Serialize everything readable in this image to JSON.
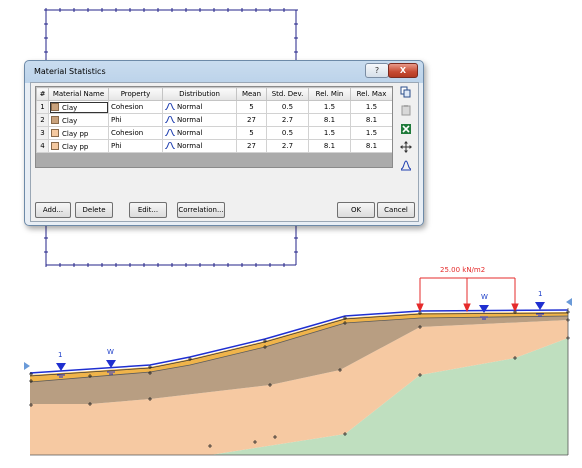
{
  "dialog": {
    "title": "Material Statistics",
    "help_label": "?",
    "close_label": "X"
  },
  "table": {
    "headers": [
      "#",
      "Material Name",
      "Property",
      "Distribution",
      "Mean",
      "Std. Dev.",
      "Rel. Min",
      "Rel. Max"
    ],
    "rows": [
      {
        "num": "1",
        "name": "Clay",
        "property": "Cohesion",
        "distribution": "Normal",
        "mean": "5",
        "std": "0.5",
        "min": "1.5",
        "max": "1.5",
        "color": "#c9a27c"
      },
      {
        "num": "2",
        "name": "Clay",
        "property": "Phi",
        "distribution": "Normal",
        "mean": "27",
        "std": "2.7",
        "min": "8.1",
        "max": "8.1",
        "color": "#c9a27c"
      },
      {
        "num": "3",
        "name": "Clay pp",
        "property": "Cohesion",
        "distribution": "Normal",
        "mean": "5",
        "std": "0.5",
        "min": "1.5",
        "max": "1.5",
        "color": "#f5c9a0"
      },
      {
        "num": "4",
        "name": "Clay pp",
        "property": "Phi",
        "distribution": "Normal",
        "mean": "27",
        "std": "2.7",
        "min": "8.1",
        "max": "8.1",
        "color": "#f5c9a0"
      }
    ]
  },
  "buttons": {
    "add": "Add...",
    "delete": "Delete",
    "edit": "Edit...",
    "correlation": "Correlation...",
    "ok": "OK",
    "cancel": "Cancel"
  },
  "tools": {
    "copy_icon": "copy-icon",
    "paste_icon": "paste-icon",
    "excel_icon": "excel-icon",
    "move_icon": "move-icon",
    "distribution_icon": "distribution-icon"
  },
  "model": {
    "load_label": "25.00 kN/m2",
    "water_label_left_number": "1",
    "water_label_left_w": "W",
    "water_label_right_w": "W",
    "water_label_right_number": "1",
    "colors": {
      "lower_layer": "#bfdfbf",
      "middle_layer": "#f6c9a2",
      "upper_layer": "#b89e82",
      "top_strip": "#f0b44a",
      "water_line": "#1f2fd0",
      "load": "#e52b2b"
    }
  }
}
